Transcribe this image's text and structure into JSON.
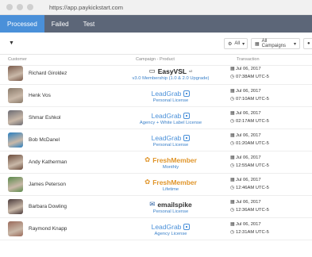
{
  "browser": {
    "url": "https://app.paykickstart.com"
  },
  "tabs": [
    {
      "label": "Processed",
      "active": true
    },
    {
      "label": "Failed",
      "active": false
    },
    {
      "label": "Test",
      "active": false
    }
  ],
  "filters": {
    "caret": "▼",
    "status_value": "All",
    "campaign_value": "All Campaigns",
    "status_icon": "gear-icon",
    "campaign_icon": "grid-icon"
  },
  "columns": {
    "customer": "Customer",
    "product": "Campaign - Product",
    "transaction": "Transaction"
  },
  "colors": {
    "tab_active": "#4a90d9",
    "tabbar": "#5c6678",
    "link": "#3a80c9"
  },
  "rows": [
    {
      "name": "Richard Giroldez",
      "logo": "EasyVSL",
      "logo_sup": "v2",
      "logo_color": "#222",
      "plan": "v3.0 Membership (1.0 & 2.0 Upgrade)",
      "date": "Jul 06, 2017",
      "time": "07:38AM UTC-5",
      "avatar_color": "#7a5a4a"
    },
    {
      "name": "Henk Vos",
      "logo": "LeadGrab",
      "logo_sup": "",
      "logo_color": "#4a90d9",
      "plan": "Personal License",
      "date": "Jul 06, 2017",
      "time": "07:10AM UTC-5",
      "avatar_color": "#8a7a6a"
    },
    {
      "name": "Shmar Eshkol",
      "logo": "LeadGrab",
      "logo_sup": "",
      "logo_color": "#4a90d9",
      "plan": "Agency + White Label License",
      "date": "Jul 06, 2017",
      "time": "02:17AM UTC-5",
      "avatar_color": "#6a6a72"
    },
    {
      "name": "Bob McDanel",
      "logo": "LeadGrab",
      "logo_sup": "",
      "logo_color": "#4a90d9",
      "plan": "Personal License",
      "date": "Jul 06, 2017",
      "time": "01:20AM UTC-5",
      "avatar_color": "#2a7fc0"
    },
    {
      "name": "Andy Katherman",
      "logo": "FreshMember",
      "logo_sup": "",
      "logo_color": "#333",
      "plan": "Monthly",
      "date": "Jul 06, 2017",
      "time": "12:55AM UTC-5",
      "avatar_color": "#6a4a3a"
    },
    {
      "name": "James Peterson",
      "logo": "FreshMember",
      "logo_sup": "",
      "logo_color": "#333",
      "plan": "Lifetime",
      "date": "Jul 06, 2017",
      "time": "12:46AM UTC-5",
      "avatar_color": "#5a8a4a"
    },
    {
      "name": "Barbara Dowling",
      "logo": "emailspike",
      "logo_sup": "",
      "logo_color": "#333",
      "plan": "Personal License",
      "date": "Jul 06, 2017",
      "time": "12:36AM UTC-5",
      "avatar_color": "#4a3a3a"
    },
    {
      "name": "Raymond Knapp",
      "logo": "LeadGrab",
      "logo_sup": "",
      "logo_color": "#4a90d9",
      "plan": "Agency License",
      "date": "Jul 06, 2017",
      "time": "12:31AM UTC-5",
      "avatar_color": "#9a6a5a"
    }
  ]
}
